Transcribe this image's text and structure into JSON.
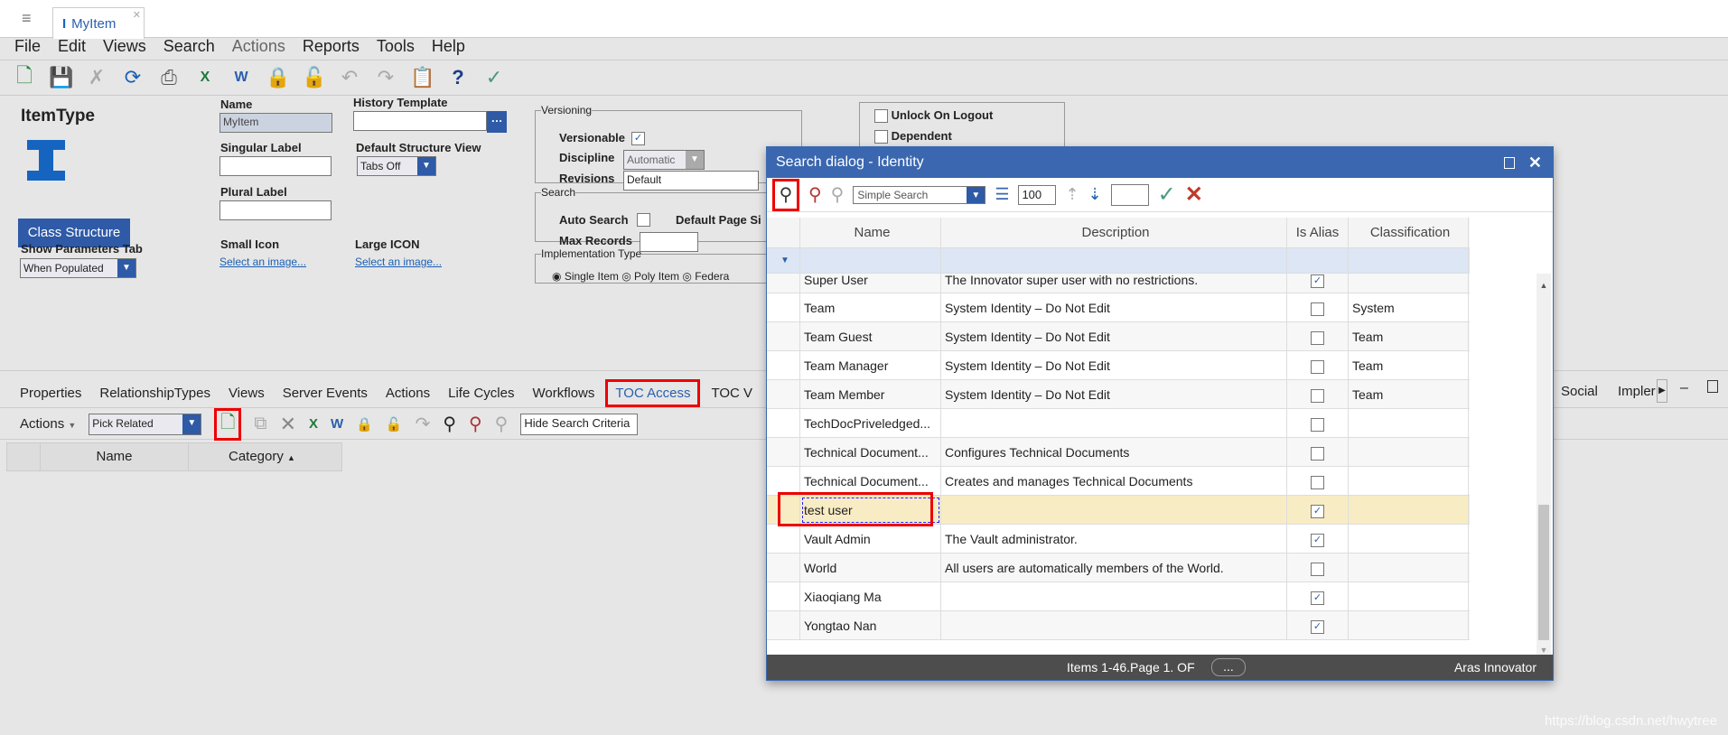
{
  "tab": {
    "title": "MyItem"
  },
  "menu": [
    "File",
    "Edit",
    "Views",
    "Search",
    "Actions",
    "Reports",
    "Tools",
    "Help"
  ],
  "form": {
    "heading": "ItemType",
    "name_label": "Name",
    "name_value": "MyItem",
    "singular_label": "Singular Label",
    "plural_label": "Plural Label",
    "history_label": "History Template",
    "structure_label": "Default Structure View",
    "structure_value": "Tabs Off",
    "class_structure": "Class Structure",
    "params_label": "Show Parameters Tab",
    "params_value": "When Populated",
    "small_icon": "Small Icon",
    "large_icon": "Large ICON",
    "select_image": "Select an image...",
    "versioning": "Versioning",
    "versionable": "Versionable",
    "discipline": "Discipline",
    "discipline_value": "Automatic",
    "revisions": "Revisions",
    "revisions_value": "Default",
    "search": "Search",
    "auto_search": "Auto Search",
    "default_page_size": "Default Page Si",
    "max_records": "Max Records",
    "impl": "Implementation Type",
    "single": "Single Item",
    "poly": "Poly Item",
    "federated": "Federa",
    "unlock": "Unlock On Logout",
    "dependent": "Dependent"
  },
  "reltabs": [
    "Properties",
    "RelationshipTypes",
    "Views",
    "Server Events",
    "Actions",
    "Life Cycles",
    "Workflows",
    "TOC Access",
    "TOC V"
  ],
  "reltabs_right": [
    "Social",
    "Impler"
  ],
  "reltoolbar": {
    "actions": "Actions",
    "pick": "Pick Related",
    "hide": "Hide Search Criteria"
  },
  "relgrid": {
    "cols": [
      "Name",
      "Category"
    ]
  },
  "dialog": {
    "title": "Search dialog - Identity",
    "search_mode": "Simple Search",
    "page_size": "100",
    "columns": [
      "Name",
      "Description",
      "Is Alias",
      "Classification"
    ],
    "rows": [
      {
        "name": "Super User",
        "desc": "The Innovator super user with no restrictions.",
        "alias": true,
        "cls": ""
      },
      {
        "name": "Team",
        "desc": "System Identity – Do Not Edit",
        "alias": false,
        "cls": "System"
      },
      {
        "name": "Team Guest",
        "desc": "System Identity – Do Not Edit",
        "alias": false,
        "cls": "Team"
      },
      {
        "name": "Team Manager",
        "desc": "System Identity – Do Not Edit",
        "alias": false,
        "cls": "Team"
      },
      {
        "name": "Team Member",
        "desc": "System Identity – Do Not Edit",
        "alias": false,
        "cls": "Team"
      },
      {
        "name": "TechDocPriveledged...",
        "desc": "",
        "alias": false,
        "cls": ""
      },
      {
        "name": "Technical Document...",
        "desc": "Configures Technical Documents",
        "alias": false,
        "cls": ""
      },
      {
        "name": "Technical Document...",
        "desc": "Creates and manages Technical Documents",
        "alias": false,
        "cls": ""
      },
      {
        "name": "test user",
        "desc": "",
        "alias": true,
        "cls": "",
        "selected": true
      },
      {
        "name": "Vault Admin",
        "desc": "The Vault administrator.",
        "alias": true,
        "cls": ""
      },
      {
        "name": "World",
        "desc": "All users are automatically members of the World.",
        "alias": false,
        "cls": ""
      },
      {
        "name": "Xiaoqiang Ma",
        "desc": "",
        "alias": true,
        "cls": ""
      },
      {
        "name": "Yongtao Nan",
        "desc": "",
        "alias": true,
        "cls": ""
      }
    ],
    "footer": "Items 1-46.Page 1. OF",
    "more": "...",
    "brand": "Aras Innovator"
  },
  "watermark": "https://blog.csdn.net/hwytree"
}
